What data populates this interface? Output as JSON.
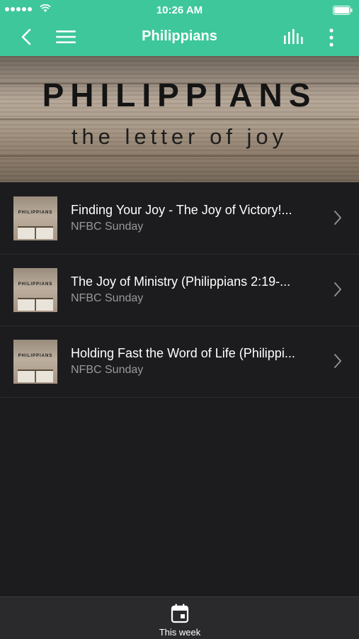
{
  "status_bar": {
    "time": "10:26 AM"
  },
  "nav": {
    "title": "Philippians"
  },
  "banner": {
    "title": "PHILIPPIANS",
    "subtitle": "the letter of joy"
  },
  "thumbnail": {
    "text": "PHILIPPIANS"
  },
  "sermons": [
    {
      "title": "Finding Your Joy - The Joy of Victory!...",
      "subtitle": "NFBC Sunday"
    },
    {
      "title": "The Joy of Ministry (Philippians 2:19-...",
      "subtitle": "NFBC Sunday"
    },
    {
      "title": "Holding Fast the Word of Life (Philippi...",
      "subtitle": "NFBC Sunday"
    }
  ],
  "tab_bar": {
    "this_week_label": "This week"
  },
  "colors": {
    "accent": "#3ec79a",
    "background": "#1c1c1e",
    "secondary_text": "#98989d"
  },
  "icons": [
    "back-icon",
    "menu-icon",
    "stats-icon",
    "more-icon",
    "chevron-right-icon",
    "calendar-icon"
  ]
}
